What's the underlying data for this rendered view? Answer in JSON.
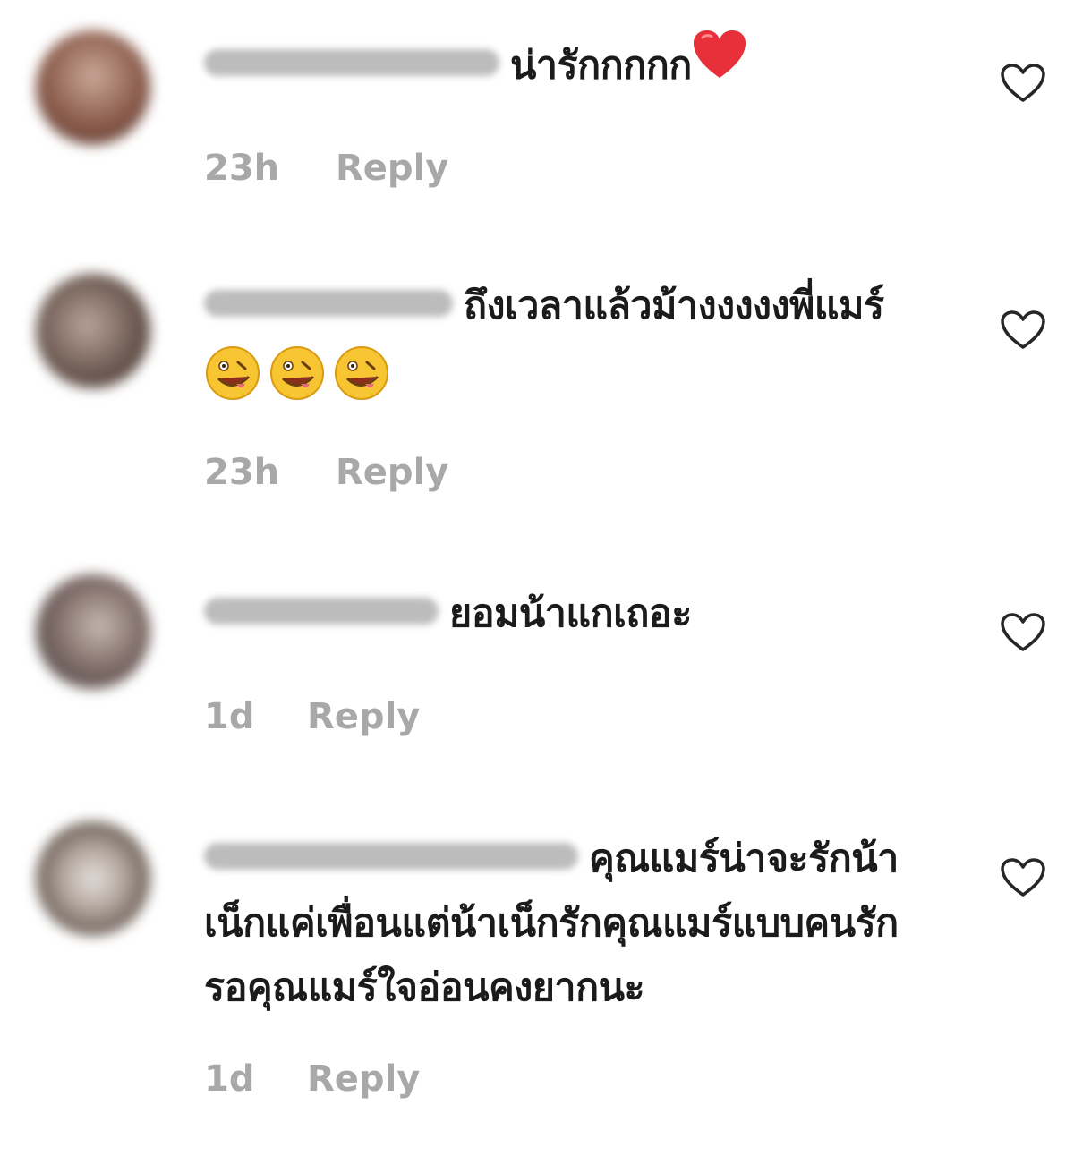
{
  "comments": [
    {
      "text": "น่ารักกกกก",
      "time": "23h",
      "reply_label": "Reply",
      "trailing_icon": "red-heart-icon",
      "avatar_color": "#8a5a4a"
    },
    {
      "text": "ถึงเวลาแล้วม้างงงงงพี่แมร์",
      "time": "23h",
      "reply_label": "Reply",
      "trailing_icon": "zany-face-icon",
      "avatar_color": "#6d5a52"
    },
    {
      "text": "ยอมน้าแกเถอะ",
      "time": "1d",
      "reply_label": "Reply",
      "avatar_color": "#7d6a66"
    },
    {
      "text": "คุณแมร์น่าจะรักน้าเน็กแค่เพื่อนแต่น้าเน็กรักคุณแมร์แบบคนรัก รอคุณแมร์ใจอ่อนคงยากนะ",
      "time": "1d",
      "reply_label": "Reply",
      "avatar_color": "#6f6259"
    }
  ],
  "icons": {
    "like": "heart-outline-icon"
  },
  "colors": {
    "text": "#1b1b1b",
    "meta": "#a8a8a8",
    "heart_red": "#e8303a",
    "like_outline": "#262626"
  }
}
